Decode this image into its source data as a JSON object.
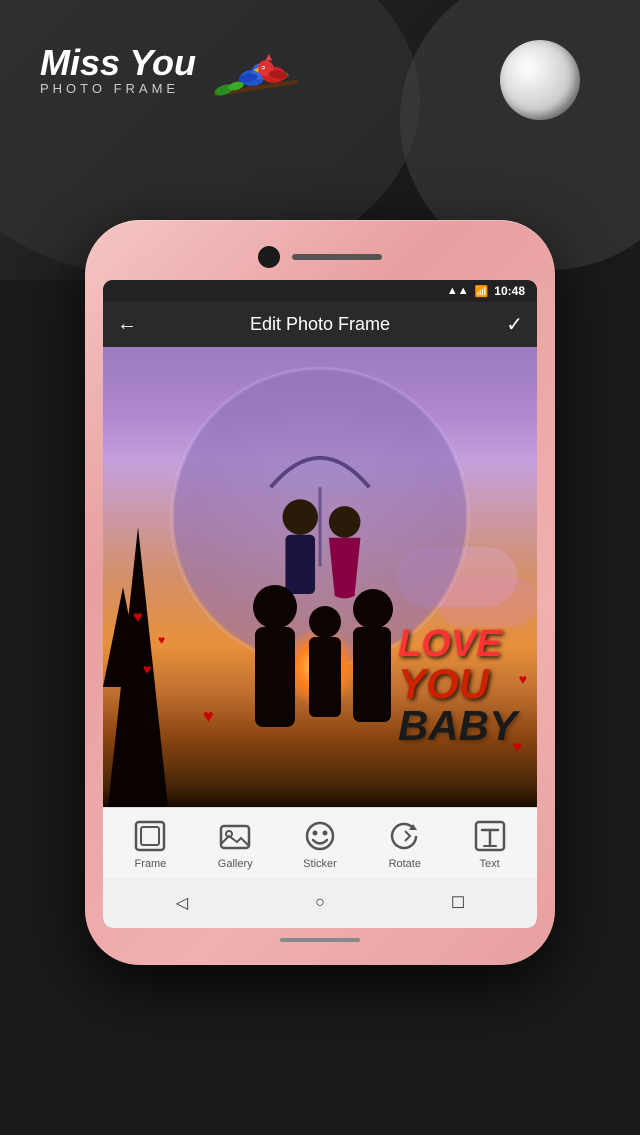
{
  "app": {
    "name": "Miss You Photo Frame",
    "title": "Miss You",
    "subtitle": "PHOTO FRAME"
  },
  "status_bar": {
    "time": "10:48",
    "signal": "▲▲",
    "battery": "▪"
  },
  "toolbar": {
    "back_icon": "←",
    "title": "Edit Photo Frame",
    "check_icon": "✓"
  },
  "love_text": {
    "line1": "LOVE",
    "line2": "YOU",
    "line3": "BABY"
  },
  "bottom_toolbar": {
    "items": [
      {
        "icon": "⬜",
        "label": "Frame"
      },
      {
        "icon": "🖼",
        "label": "Gallery"
      },
      {
        "icon": "😎",
        "label": "Sticker"
      },
      {
        "icon": "↻",
        "label": "Rotate"
      },
      {
        "icon": "✏",
        "label": "Text"
      }
    ]
  },
  "nav": {
    "back": "◁",
    "home": "○",
    "recent": "☐"
  }
}
